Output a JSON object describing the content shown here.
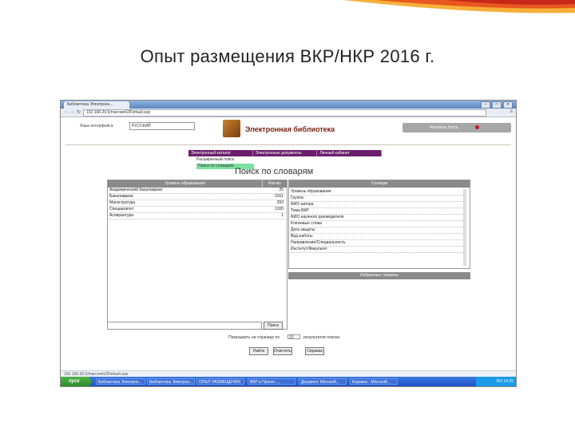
{
  "slide": {
    "title": "Опыт размещения ВКР/НКР 2016 г."
  },
  "browser": {
    "tab_title": "Библиотека Электронн...",
    "window_buttons": [
      "–",
      "□",
      "✕"
    ],
    "nav_back": "←",
    "nav_forward": "→",
    "nav_reload": "↻",
    "address": "192.168.20.5/marcweb2/Default.asp",
    "menu_icon": "≡"
  },
  "page": {
    "language_label": "Язык интерфейса:",
    "language_value": "РУССКИЙ",
    "logo_text": "Электронная библиотека",
    "reader_label": "Читатель Гость",
    "menu": [
      "Электронный каталог",
      "Электронные документы",
      "Личный кабинет"
    ],
    "submenu": [
      "Расширенный поиск",
      "Поиск по словарям"
    ],
    "search_title": "Поиск по словарям",
    "left_table": {
      "col_level": "Уровень образования",
      "col_count": "Кол-во",
      "rows": [
        {
          "name": "Академический бакалавриат",
          "count": "25"
        },
        {
          "name": "Бакалавриат",
          "count": "3161"
        },
        {
          "name": "Магистратура",
          "count": "293"
        },
        {
          "name": "Специалитет",
          "count": "1165"
        },
        {
          "name": "Аспирантура",
          "count": "1"
        }
      ]
    },
    "right_table": {
      "header": "Словари",
      "items": [
        "Уровень образования",
        "Группа",
        "ФИО автора",
        "Тема ВКР",
        "ФИО научного руководителя",
        "Ключевые слова",
        "Дата защиты",
        "Вид работы",
        "Направление/Специальность",
        "Институт/Факультет"
      ]
    },
    "favorites_header": "Избранные термины",
    "search_button": "Поиск",
    "per_page_label_before": "Показывать на странице по",
    "per_page_value": "10",
    "per_page_label_after": "результатов поиска",
    "buttons": [
      "Найти",
      "Очистить",
      "Справка"
    ],
    "status_text": "192.168.20.5/marcweb2/Default.asp"
  },
  "taskbar": {
    "start": "пуск",
    "tasks": [
      "Библиотека Электрон...",
      "Библиотека Электрон...",
      "ОПЫТ РАЗМЕЩЕНИЯ",
      "ВКР и Проект ...",
      "Документ Microsoft...",
      "Корзина - Microsoft..."
    ],
    "tray": "RU 14:25"
  }
}
